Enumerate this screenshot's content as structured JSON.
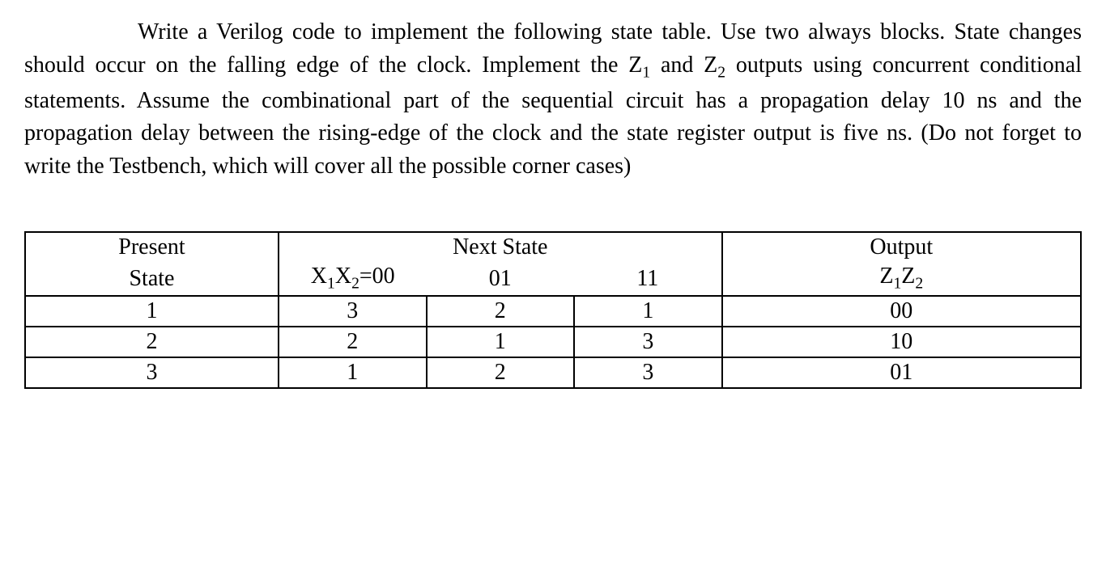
{
  "paragraph": {
    "text1": "Write a Verilog code to implement the following state table. Use two always blocks. State changes should occur on the falling edge of the clock. Implement the Z",
    "sub1": "1",
    "text2": " and Z",
    "sub2": "2",
    "text3": " outputs using concurrent conditional statements. Assume the combinational part of the sequential circuit has a propagation delay 10 ns and the propagation delay between the rising-edge of the clock and the state register output is five ns. (Do not forget to write the Testbench, which will cover all the possible corner cases)"
  },
  "table": {
    "header": {
      "present_line1": "Present",
      "present_line2": "State",
      "next_state": "Next State",
      "input_prefix": "X",
      "input_sub1": "1",
      "input_mid": "X",
      "input_sub2": "2",
      "input_suffix": "=00",
      "col01": "01",
      "col11": "11",
      "output_line1": "Output",
      "output_prefix": "Z",
      "output_sub1": "1",
      "output_mid": "Z",
      "output_sub2": "2"
    },
    "rows": [
      {
        "state": "1",
        "ns00": "3",
        "ns01": "2",
        "ns11": "1",
        "out": "00"
      },
      {
        "state": "2",
        "ns00": "2",
        "ns01": "1",
        "ns11": "3",
        "out": "10"
      },
      {
        "state": "3",
        "ns00": "1",
        "ns01": "2",
        "ns11": "3",
        "out": "01"
      }
    ]
  }
}
